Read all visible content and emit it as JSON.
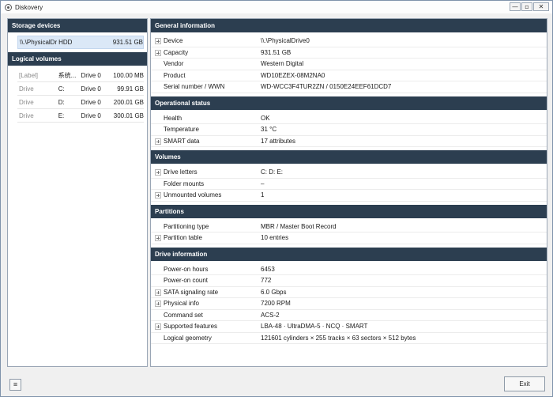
{
  "window": {
    "title": "Diskovery",
    "controls": {
      "minimize": "—",
      "maximize": "▫",
      "close": "✕"
    }
  },
  "left": {
    "storage_header": "Storage devices",
    "storage_devices": [
      {
        "name": "\\\\.\\PhysicalDri...",
        "type": "HDD",
        "size": "931.51 GB"
      }
    ],
    "logical_header": "Logical volumes",
    "logical_volumes": [
      {
        "kind": "[Label]",
        "name": "系统...",
        "drive": "Drive 0",
        "size": "100.00 MB"
      },
      {
        "kind": "Drive",
        "name": "C:",
        "drive": "Drive 0",
        "size": "99.91 GB"
      },
      {
        "kind": "Drive",
        "name": "D:",
        "drive": "Drive 0",
        "size": "200.01 GB"
      },
      {
        "kind": "Drive",
        "name": "E:",
        "drive": "Drive 0",
        "size": "300.01 GB"
      }
    ]
  },
  "sections": [
    {
      "title": "General information",
      "rows": [
        {
          "key": "Device",
          "value": "\\\\.\\PhysicalDrive0",
          "expandable": true
        },
        {
          "key": "Capacity",
          "value": "931.51 GB",
          "expandable": true
        },
        {
          "key": "Vendor",
          "value": "Western Digital",
          "expandable": false
        },
        {
          "key": "Product",
          "value": "WD10EZEX-08M2NA0",
          "expandable": false
        },
        {
          "key": "Serial number / WWN",
          "value": "WD-WCC3F4TUR2ZN / 0150E24EEF61DCD7",
          "expandable": false
        }
      ]
    },
    {
      "title": "Operational status",
      "rows": [
        {
          "key": "Health",
          "value": "OK",
          "expandable": false
        },
        {
          "key": "Temperature",
          "value": "31 °C",
          "expandable": false
        },
        {
          "key": "SMART data",
          "value": "17 attributes",
          "expandable": true
        }
      ]
    },
    {
      "title": "Volumes",
      "rows": [
        {
          "key": "Drive letters",
          "value": "C:  D:  E:",
          "expandable": true
        },
        {
          "key": "Folder mounts",
          "value": "–",
          "expandable": false
        },
        {
          "key": "Unmounted volumes",
          "value": "1",
          "expandable": true
        }
      ]
    },
    {
      "title": "Partitions",
      "rows": [
        {
          "key": "Partitioning type",
          "value": "MBR / Master Boot Record",
          "expandable": false
        },
        {
          "key": "Partition table",
          "value": "10 entries",
          "expandable": true
        }
      ]
    },
    {
      "title": "Drive information",
      "rows": [
        {
          "key": "Power-on hours",
          "value": "6453",
          "expandable": false
        },
        {
          "key": "Power-on count",
          "value": "772",
          "expandable": false
        },
        {
          "key": "SATA signaling rate",
          "value": "6.0 Gbps",
          "expandable": true
        },
        {
          "key": "Physical info",
          "value": "7200 RPM",
          "expandable": true
        },
        {
          "key": "Command set",
          "value": "ACS-2",
          "expandable": false
        },
        {
          "key": "Supported features",
          "value": "LBA-48  ·  UltraDMA-5  ·  NCQ  ·  SMART",
          "expandable": true
        },
        {
          "key": "Logical geometry",
          "value": "121601 cylinders × 255 tracks × 63 sectors × 512 bytes",
          "expandable": false
        }
      ]
    }
  ],
  "bottom": {
    "menu_label": "≡",
    "exit_label": "Exit"
  },
  "colors": {
    "header_bg": "#2c3e50",
    "selection_bg": "#dbe8f7"
  }
}
